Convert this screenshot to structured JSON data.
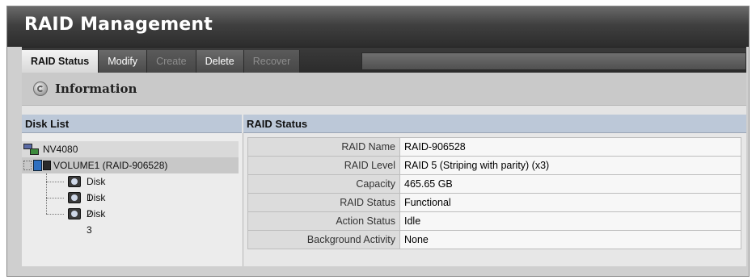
{
  "app": {
    "title": "RAID Management"
  },
  "tabs": [
    {
      "label": "RAID Status",
      "state": "active"
    },
    {
      "label": "Modify",
      "state": "enabled"
    },
    {
      "label": "Create",
      "state": "disabled"
    },
    {
      "label": "Delete",
      "state": "enabled"
    },
    {
      "label": "Recover",
      "state": "disabled"
    }
  ],
  "info": {
    "title": "Information",
    "icon": "info-disc-icon"
  },
  "disk_list": {
    "header": "Disk List",
    "server": {
      "label": "NV4080",
      "icon": "server-icon"
    },
    "volume": {
      "label": "VOLUME1 (RAID-906528)",
      "icon": "volume-icon"
    },
    "disks": [
      {
        "label": "Disk 1",
        "icon": "disk-icon"
      },
      {
        "label": "Disk 2",
        "icon": "disk-icon"
      },
      {
        "label": "Disk 3",
        "icon": "disk-icon"
      }
    ]
  },
  "raid_status": {
    "header": "RAID Status",
    "rows": [
      {
        "key": "RAID Name",
        "value": "RAID-906528"
      },
      {
        "key": "RAID Level",
        "value": "RAID 5 (Striping with parity) (x3)"
      },
      {
        "key": "Capacity",
        "value": "465.65 GB"
      },
      {
        "key": "RAID Status",
        "value": "Functional"
      },
      {
        "key": "Action Status",
        "value": "Idle"
      },
      {
        "key": "Background Activity",
        "value": "None"
      }
    ]
  }
}
